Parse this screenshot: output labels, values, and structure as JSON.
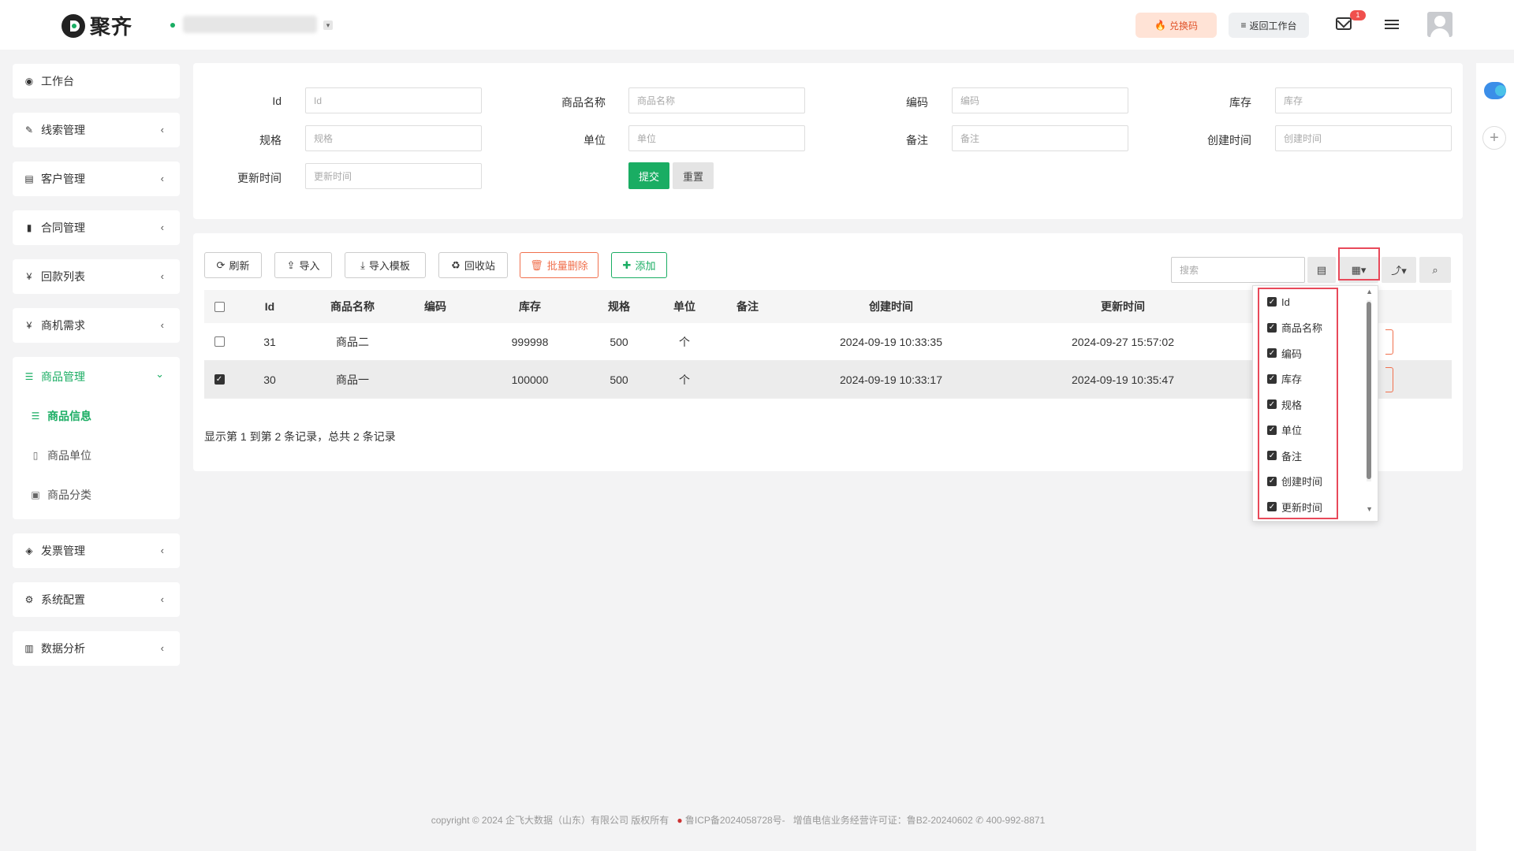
{
  "brand": {
    "name": "聚齐"
  },
  "topbar": {
    "redeem_label": "兑换码",
    "back_label": "返回工作台",
    "mail_badge": "1"
  },
  "sidebar": {
    "items": [
      {
        "icon": "dashboard-icon",
        "glyph": "◉",
        "label": "工作台",
        "has_chevron": false
      },
      {
        "icon": "link-icon",
        "glyph": "✎",
        "label": "线索管理",
        "has_chevron": true
      },
      {
        "icon": "id-card-icon",
        "glyph": "▤",
        "label": "客户管理",
        "has_chevron": true
      },
      {
        "icon": "bookmark-icon",
        "glyph": "▮",
        "label": "合同管理",
        "has_chevron": true
      },
      {
        "icon": "yen-icon",
        "glyph": "¥",
        "label": "回款列表",
        "has_chevron": true
      },
      {
        "icon": "yen-icon",
        "glyph": "¥",
        "label": "商机需求",
        "has_chevron": true
      },
      {
        "icon": "list-icon",
        "glyph": "☰",
        "label": "商品管理",
        "has_chevron": true,
        "expanded": true,
        "children": [
          {
            "icon": "list-icon",
            "glyph": "☰",
            "label": "商品信息",
            "current": true
          },
          {
            "icon": "document-icon",
            "glyph": "▯",
            "label": "商品单位"
          },
          {
            "icon": "calendar-plus-icon",
            "glyph": "▣",
            "label": "商品分类"
          }
        ]
      },
      {
        "icon": "ticket-icon",
        "glyph": "◈",
        "label": "发票管理",
        "has_chevron": true
      },
      {
        "icon": "cogs-icon",
        "glyph": "⚙",
        "label": "系统配置",
        "has_chevron": true
      },
      {
        "icon": "bar-chart-icon",
        "glyph": "▥",
        "label": "数据分析",
        "has_chevron": true
      }
    ]
  },
  "filters": {
    "fields": [
      {
        "label": "Id",
        "placeholder": "Id"
      },
      {
        "label": "商品名称",
        "placeholder": "商品名称"
      },
      {
        "label": "编码",
        "placeholder": "编码"
      },
      {
        "label": "库存",
        "placeholder": "库存"
      },
      {
        "label": "规格",
        "placeholder": "规格"
      },
      {
        "label": "单位",
        "placeholder": "单位"
      },
      {
        "label": "备注",
        "placeholder": "备注"
      },
      {
        "label": "创建时间",
        "placeholder": "创建时间"
      },
      {
        "label": "更新时间",
        "placeholder": "更新时间"
      }
    ],
    "submit_label": "提交",
    "reset_label": "重置"
  },
  "toolbar": {
    "refresh_label": "刷新",
    "import_label": "导入",
    "import_template_label": "导入模板",
    "recycle_label": "回收站",
    "batch_delete_label": "批量删除",
    "add_label": "添加",
    "search_placeholder": "搜索"
  },
  "table": {
    "columns": [
      "Id",
      "商品名称",
      "编码",
      "库存",
      "规格",
      "单位",
      "备注",
      "创建时间",
      "更新时间"
    ],
    "rows": [
      {
        "checked": false,
        "id": "31",
        "name": "商品二",
        "code": "",
        "stock": "999998",
        "spec": "500",
        "unit": "个",
        "remark": "",
        "created": "2024-09-19 10:33:35",
        "updated": "2024-09-27 15:57:02"
      },
      {
        "checked": true,
        "id": "30",
        "name": "商品一",
        "code": "",
        "stock": "100000",
        "spec": "500",
        "unit": "个",
        "remark": "",
        "created": "2024-09-19 10:33:17",
        "updated": "2024-09-19 10:35:47"
      }
    ],
    "pager_text": "显示第 1 到第 2 条记录，总共 2 条记录"
  },
  "column_menu": {
    "options": [
      "Id",
      "商品名称",
      "编码",
      "库存",
      "规格",
      "单位",
      "备注",
      "创建时间",
      "更新时间"
    ]
  },
  "footer": {
    "text": "copyright © 2024 企飞大数据（山东）有限公司 版权所有",
    "icp": "鲁ICP备2024058728号-",
    "license": "增值电信业务经营许可证：鲁B2-20240602",
    "phone": "400-992-8871"
  },
  "colors": {
    "accent": "#1aad63",
    "danger": "#f0704d",
    "highlight": "#e8495a"
  }
}
